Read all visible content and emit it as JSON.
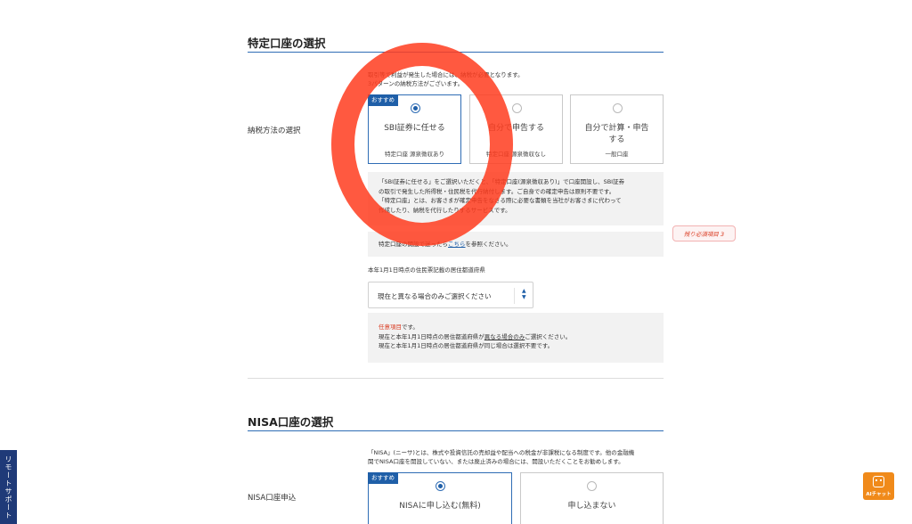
{
  "tokutei": {
    "title": "特定口座の選択",
    "tax_label": "納税方法の選択",
    "intro_lines": [
      "取引等で利益が発生した場合には、納税が必要となります。",
      "3パターンの納税方法がございます。"
    ],
    "options": [
      {
        "badge": "おすすめ",
        "title": "SBI証券に任せる",
        "sub": "特定口座 源泉徴収あり",
        "selected": true
      },
      {
        "title": "自分で申告する",
        "sub": "特定口座 源泉徴収なし",
        "selected": false
      },
      {
        "title_lines": [
          "自分で計算・申告",
          "する"
        ],
        "sub": "一般口座",
        "selected": false
      }
    ],
    "note_lines": [
      "「SBI証券に任せる」をご選択いただくと、「特定口座(源泉徴収あり)」で口座開設し、SBI証券",
      "の取引で発生した所得税・住民税を代行納付します。ご自身での確定申告は原則不要です。",
      "「特定口座」とは、お客さまが確定申告をなさる際に必要な書類を当社がお客さまに代わって",
      "作成したり、納税を代行したりするサービスです。"
    ],
    "closure_note_before": "特定口座の開設で迷ったら",
    "closure_note_link": "こちら",
    "closure_note_after": "を参照ください。",
    "remaining_badge": "残り必須項目 3",
    "residence_label": "本年1月1日時点の住民票記載の居住都道府県",
    "residence_select": "現在と異なる場合のみご選択ください",
    "optional_word": "任意項目",
    "optional_suffix": "です。",
    "residence_note_1a": "現在と本年1月1日時点の居住都道府県が",
    "residence_note_1b": "異なる場合のみ",
    "residence_note_1c": "ご選択ください。",
    "residence_note_2": "現在と本年1月1日時点の居住都道府県が同じ場合は選択不要です。"
  },
  "nisa": {
    "title": "NISA口座の選択",
    "apply_label": "NISA口座申込",
    "intro_lines": [
      "「NISA」(ニーサ)とは、株式や投資信託の売却益や配当への税金が非課税になる制度です。他の金融機",
      "関でNISA口座を開設していない、または廃止済みの場合には、開設いただくことをお勧めします。"
    ],
    "options": [
      {
        "badge": "おすすめ",
        "title": "NISAに申し込む(無料)",
        "selected": true
      },
      {
        "title": "申し込まない",
        "selected": false
      }
    ]
  },
  "side_tab": "リモートサポート",
  "ai_chat_label": "AIチャット",
  "colors": {
    "accent": "#1f5fa8",
    "warning": "#d9381e",
    "ai_button": "#f08a1a",
    "side_tab": "#1f3a78"
  }
}
